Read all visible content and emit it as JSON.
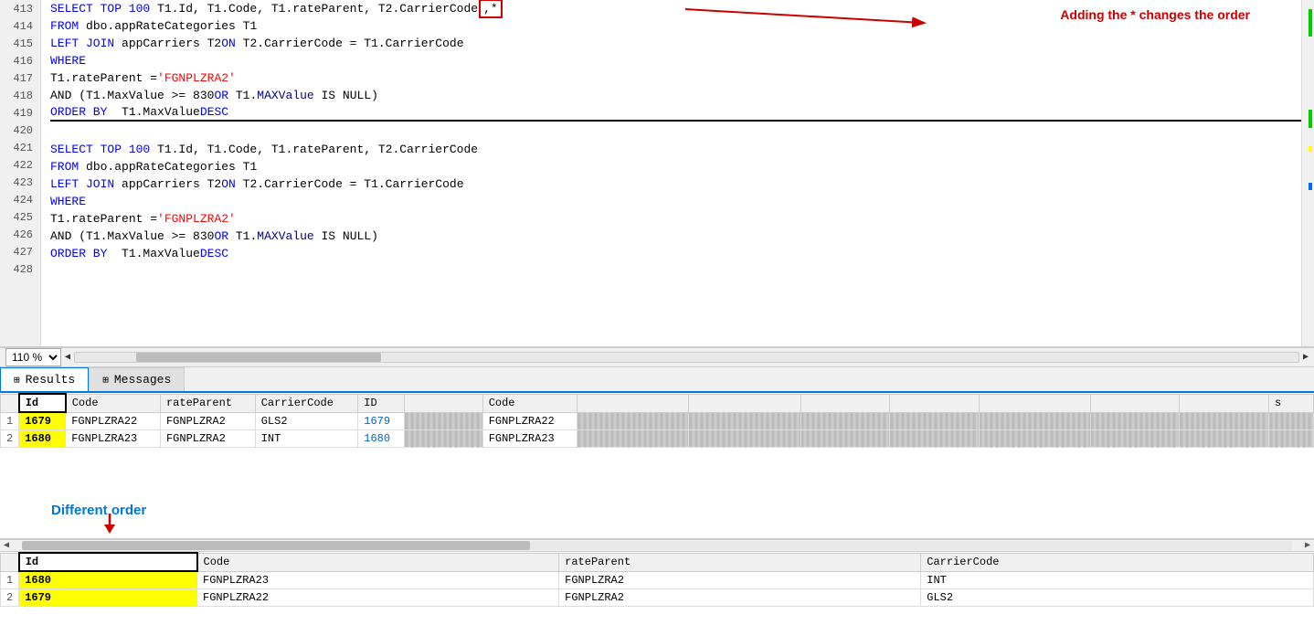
{
  "editor": {
    "zoom": "110 %",
    "lines": [
      {
        "num": 413,
        "tokens": [
          {
            "t": "SELECT TOP 100 T1.Id, T1.Code, T1.rateParent, T2.CarrierCode",
            "cls": "kw-line413"
          },
          {
            "t": " ,*",
            "cls": "highlight"
          }
        ]
      },
      {
        "num": 414,
        "tokens": [
          {
            "t": "FROM",
            "cls": "kw"
          },
          {
            "t": " dbo.appRateCategories T1",
            "cls": "plain"
          }
        ]
      },
      {
        "num": 415,
        "tokens": [
          {
            "t": "LEFT JOIN",
            "cls": "kw"
          },
          {
            "t": " appCarriers T2 ",
            "cls": "plain"
          },
          {
            "t": "ON",
            "cls": "kw"
          },
          {
            "t": " T2.CarrierCode = T1.CarrierCode",
            "cls": "plain"
          }
        ]
      },
      {
        "num": 416,
        "tokens": [
          {
            "t": "WHERE",
            "cls": "kw"
          }
        ]
      },
      {
        "num": 417,
        "tokens": [
          {
            "t": "T1.rateParent = ",
            "cls": "plain"
          },
          {
            "t": "'FGNPLZRA2'",
            "cls": "str"
          }
        ]
      },
      {
        "num": 418,
        "tokens": [
          {
            "t": "AND (T1.MaxValue >= 830 ",
            "cls": "plain"
          },
          {
            "t": "OR",
            "cls": "kw"
          },
          {
            "t": " T1.",
            "cls": "plain"
          },
          {
            "t": "MAXValue",
            "cls": "kw2"
          },
          {
            "t": " IS NULL)",
            "cls": "plain"
          }
        ]
      },
      {
        "num": 419,
        "tokens": [
          {
            "t": "ORDER BY",
            "cls": "kw"
          },
          {
            "t": "  T1.MaxValue ",
            "cls": "plain"
          },
          {
            "t": "DESC",
            "cls": "kw"
          }
        ]
      },
      {
        "num": 420,
        "tokens": []
      },
      {
        "num": 421,
        "tokens": [
          {
            "t": "SELECT TOP 100 T1.Id, T1.Code, T1.rateParent, T2.CarrierCode",
            "cls": "plain"
          }
        ]
      },
      {
        "num": 422,
        "tokens": [
          {
            "t": "FROM",
            "cls": "kw"
          },
          {
            "t": " dbo.appRateCategories T1",
            "cls": "plain"
          }
        ]
      },
      {
        "num": 423,
        "tokens": [
          {
            "t": "LEFT JOIN",
            "cls": "kw"
          },
          {
            "t": " appCarriers T2 ",
            "cls": "plain"
          },
          {
            "t": "ON",
            "cls": "kw"
          },
          {
            "t": " T2.CarrierCode = T1.CarrierCode",
            "cls": "plain"
          }
        ]
      },
      {
        "num": 424,
        "tokens": [
          {
            "t": "WHERE",
            "cls": "kw"
          }
        ]
      },
      {
        "num": 425,
        "tokens": [
          {
            "t": "T1.rateParent = ",
            "cls": "plain"
          },
          {
            "t": "'FGNPLZRA2'",
            "cls": "str"
          }
        ]
      },
      {
        "num": 426,
        "tokens": [
          {
            "t": "AND (T1.MaxValue >= 830 ",
            "cls": "plain"
          },
          {
            "t": "OR",
            "cls": "kw"
          },
          {
            "t": " T1.",
            "cls": "plain"
          },
          {
            "t": "MAXValue",
            "cls": "kw2"
          },
          {
            "t": " IS NULL)",
            "cls": "plain"
          }
        ]
      },
      {
        "num": 427,
        "tokens": [
          {
            "t": "ORDER BY",
            "cls": "kw"
          },
          {
            "t": "  T1.MaxValue ",
            "cls": "plain"
          },
          {
            "t": "DESC",
            "cls": "kw"
          }
        ]
      },
      {
        "num": 428,
        "tokens": []
      }
    ]
  },
  "annotation": {
    "text": "Adding the * changes the order"
  },
  "tabs": [
    {
      "label": "Results",
      "icon": "⊞",
      "active": true
    },
    {
      "label": "Messages",
      "icon": "⊞",
      "active": false
    }
  ],
  "upper_results": {
    "headers": [
      "Id",
      "Code",
      "rateParent",
      "CarrierCode",
      "ID",
      "",
      "Code",
      "",
      "",
      "",
      "",
      "",
      "",
      "",
      "",
      "",
      "",
      "",
      "s"
    ],
    "rows": [
      {
        "num": 1,
        "id": "1679",
        "code": "FGNPLZRA22",
        "rateParent": "FGNPLZRA2",
        "carrierCode": "GLS2",
        "id2": "1679",
        "blurred1": true,
        "code2": "FGNPLZRA22",
        "rest": true
      },
      {
        "num": 2,
        "id": "1680",
        "code": "FGNPLZRA23",
        "rateParent": "FGNPLZRA2",
        "carrierCode": "INT",
        "id2": "1680",
        "blurred1": true,
        "code2": "FGNPLZRA23",
        "rest": true
      }
    ]
  },
  "different_order_label": "Different order",
  "lower_results": {
    "headers": [
      "Id",
      "Code",
      "rateParent",
      "CarrierCode"
    ],
    "rows": [
      {
        "num": 1,
        "id": "1680",
        "code": "FGNPLZRA23",
        "rateParent": "FGNPLZRA2",
        "carrierCode": "INT"
      },
      {
        "num": 2,
        "id": "1679",
        "code": "FGNPLZRA22",
        "rateParent": "FGNPLZRA2",
        "carrierCode": "GLS2"
      }
    ]
  }
}
